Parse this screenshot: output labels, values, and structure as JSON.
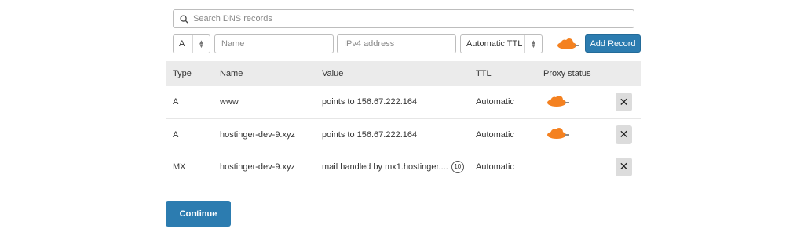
{
  "search": {
    "placeholder": "Search DNS records"
  },
  "add_form": {
    "type_value": "A",
    "name_placeholder": "Name",
    "ipv4_placeholder": "IPv4 address",
    "ttl_value": "Automatic TTL",
    "add_button_label": "Add Record"
  },
  "table": {
    "headers": [
      "Type",
      "Name",
      "Value",
      "TTL",
      "Proxy status"
    ],
    "rows": [
      {
        "type": "A",
        "name": "www",
        "value": "points to 156.67.222.164",
        "ttl": "Automatic",
        "proxied": true
      },
      {
        "type": "A",
        "name": "hostinger-dev-9.xyz",
        "value": "points to 156.67.222.164",
        "ttl": "Automatic",
        "proxied": true
      },
      {
        "type": "MX",
        "name": "hostinger-dev-9.xyz",
        "value": "mail handled by mx1.hostinger....",
        "priority": "10",
        "ttl": "Automatic",
        "proxied": false
      }
    ],
    "delete_label": "✕"
  },
  "continue_label": "Continue",
  "colors": {
    "accent": "#2c7cb0",
    "cloud": "#f48120",
    "header_bg": "#ebebeb"
  },
  "icons": {
    "search": "search-icon",
    "cloud": "cloud-proxy-icon",
    "delete": "close-icon",
    "select": "updown-arrow-icon"
  }
}
